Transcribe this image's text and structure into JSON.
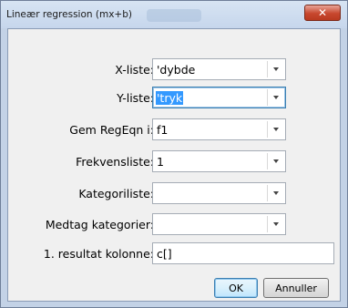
{
  "window": {
    "title": "Lineær regression (mx+b)",
    "background_text": "tryk",
    "close_label": "✕"
  },
  "form": {
    "fields": [
      {
        "label": "X-liste:",
        "value": "'dybde",
        "type": "combo"
      },
      {
        "label": "Y-liste:",
        "value": "'tryk",
        "type": "combo",
        "selected": true
      },
      {
        "label": "Gem RegEqn i:",
        "value": "f1",
        "type": "combo"
      },
      {
        "label": "Frekvensliste:",
        "value": "1",
        "type": "combo"
      },
      {
        "label": "Kategoriliste:",
        "value": "",
        "type": "combo"
      },
      {
        "label": "Medtag kategorier:",
        "value": "",
        "type": "combo"
      },
      {
        "label": "1. resultat kolonne:",
        "value": "c[]",
        "type": "text"
      }
    ]
  },
  "buttons": {
    "ok": "OK",
    "cancel": "Annuller"
  },
  "colors": {
    "selection": "#3399ff",
    "close_button": "#c8472e"
  }
}
